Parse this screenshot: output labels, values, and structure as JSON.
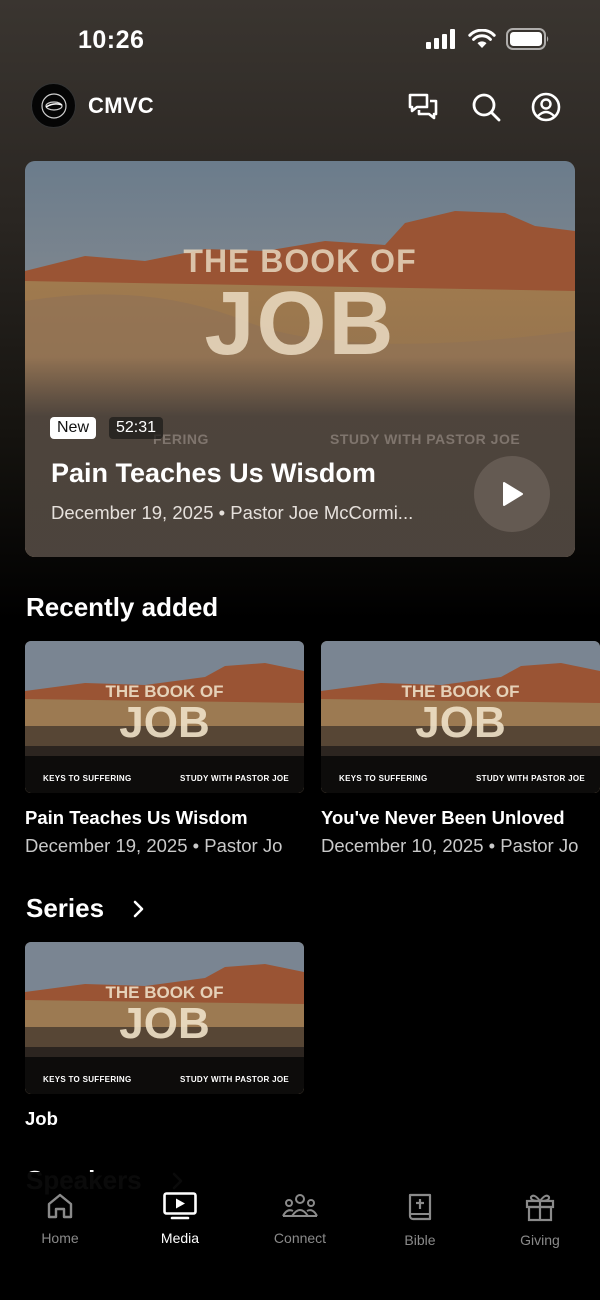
{
  "status": {
    "time": "10:26"
  },
  "header": {
    "title": "CMVC"
  },
  "hero": {
    "art_line1": "THE BOOK OF",
    "art_line2": "JOB",
    "art_left_caption": "KEYS TO SUFFERING",
    "art_left_caption_visible": "FERING",
    "art_right_caption": "STUDY WITH PASTOR JOE",
    "badge_new": "New",
    "duration": "52:31",
    "title": "Pain Teaches Us Wisdom",
    "meta": "December 19, 2025 • Pastor Joe McCormi..."
  },
  "recent": {
    "title": "Recently added",
    "items": [
      {
        "art_line1": "THE BOOK OF",
        "art_line2": "JOB",
        "caption_left": "KEYS TO SUFFERING",
        "caption_right": "STUDY WITH PASTOR JOE",
        "title": "Pain Teaches Us Wisdom",
        "meta": "December 19, 2025 • Pastor Jo"
      },
      {
        "art_line1": "THE BOOK OF",
        "art_line2": "JOB",
        "caption_left": "KEYS TO SUFFERING",
        "caption_right": "STUDY WITH PASTOR JOE",
        "title": "You've Never Been Unloved",
        "meta": "December 10, 2025 • Pastor Jo"
      }
    ]
  },
  "series": {
    "title": "Series",
    "items": [
      {
        "art_line1": "THE BOOK OF",
        "art_line2": "JOB",
        "caption_left": "KEYS TO SUFFERING",
        "caption_right": "STUDY WITH PASTOR JOE",
        "title": "Job"
      }
    ]
  },
  "speakers": {
    "title": "Speakers"
  },
  "tabs": [
    {
      "label": "Home",
      "icon": "home-icon",
      "active": false
    },
    {
      "label": "Media",
      "icon": "tv-play-icon",
      "active": true
    },
    {
      "label": "Connect",
      "icon": "people-icon",
      "active": false
    },
    {
      "label": "Bible",
      "icon": "bible-icon",
      "active": false
    },
    {
      "label": "Giving",
      "icon": "gift-icon",
      "active": false
    }
  ]
}
